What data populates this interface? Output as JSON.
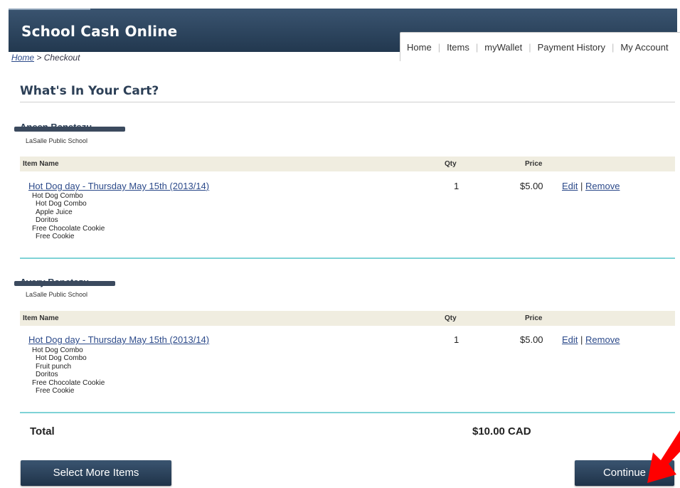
{
  "app": {
    "title": "School Cash Online"
  },
  "nav": {
    "items": [
      "Home",
      "Items",
      "myWallet",
      "Payment History",
      "My Account"
    ]
  },
  "breadcrumb": {
    "home": "Home",
    "separator": ">",
    "current": "Checkout"
  },
  "cart": {
    "title": "What's In Your Cart?",
    "columns": {
      "item_name": "Item Name",
      "qty": "Qty",
      "price": "Price"
    },
    "students": [
      {
        "name": "Aneen Banetszu",
        "school": "LaSalle Public School",
        "items": [
          {
            "name": "Hot Dog day - Thursday May 15th (2013/14)",
            "options": [
              "Hot Dog Combo",
              "Hot Dog Combo",
              "Apple Juice",
              "Doritos",
              "Free Chocolate Cookie",
              "Free Cookie"
            ],
            "qty": "1",
            "price": "$5.00",
            "edit": "Edit",
            "remove": "Remove",
            "separator": "|"
          }
        ]
      },
      {
        "name": "Avery Banetszu",
        "school": "LaSalle Public School",
        "items": [
          {
            "name": "Hot Dog day - Thursday May 15th (2013/14)",
            "options": [
              "Hot Dog Combo",
              "Hot Dog Combo",
              "Fruit punch",
              "Doritos",
              "Free Chocolate Cookie",
              "Free Cookie"
            ],
            "qty": "1",
            "price": "$5.00",
            "edit": "Edit",
            "remove": "Remove",
            "separator": "|"
          }
        ]
      }
    ],
    "total_label": "Total",
    "total_value": "$10.00 CAD"
  },
  "buttons": {
    "select_more": "Select More Items",
    "continue": "Continue"
  },
  "colors": {
    "header": "#2b425b",
    "button": "#263c54",
    "accent_rule": "#7fd3d6",
    "table_header": "#f0ede0",
    "arrow": "#ff0000"
  },
  "icons": {
    "annotation": "red-arrow-icon"
  }
}
